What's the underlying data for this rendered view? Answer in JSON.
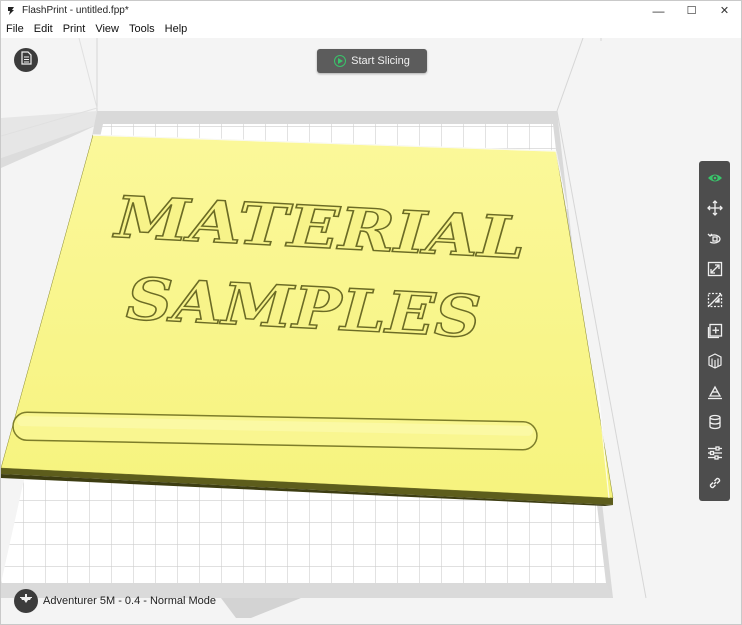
{
  "window": {
    "title": "FlashPrint - untitled.fpp*",
    "minimize_glyph": "—",
    "maximize_glyph": "☐",
    "close_glyph": "✕"
  },
  "menu": {
    "items": [
      "File",
      "Edit",
      "Print",
      "View",
      "Tools",
      "Help"
    ]
  },
  "viewport": {
    "slice_button_label": "Start Slicing",
    "model_text_line1": "MATERIAL",
    "model_text_line2": "SAMPLES",
    "model_color": "#f8f58a",
    "accent_color": "#39c46a"
  },
  "toolbar": {
    "tools": [
      {
        "name": "view-icon",
        "active": true
      },
      {
        "name": "move-icon"
      },
      {
        "name": "rotate-icon"
      },
      {
        "name": "scale-icon"
      },
      {
        "name": "cut-icon"
      },
      {
        "name": "add-support-icon"
      },
      {
        "name": "supports-icon"
      },
      {
        "name": "lay-flat-icon"
      },
      {
        "name": "material-icon"
      },
      {
        "name": "settings-icon"
      },
      {
        "name": "link-icon"
      }
    ]
  },
  "status": {
    "printer": "Adventurer 5M - 0.4 - Normal Mode"
  }
}
